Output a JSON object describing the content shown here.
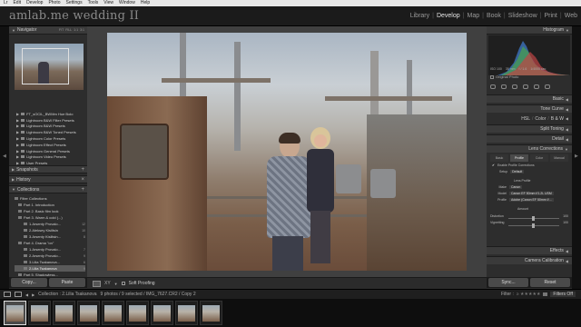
{
  "os_menu": [
    "Lr",
    "Edit",
    "Develop",
    "Photo",
    "Settings",
    "Tools",
    "View",
    "Window",
    "Help"
  ],
  "identity_plate": "amlab.me wedding II",
  "modules": [
    {
      "label": "Library",
      "active": false
    },
    {
      "label": "Develop",
      "active": true
    },
    {
      "label": "Map",
      "active": false
    },
    {
      "label": "Book",
      "active": false
    },
    {
      "label": "Slideshow",
      "active": false
    },
    {
      "label": "Print",
      "active": false
    },
    {
      "label": "Web",
      "active": false
    }
  ],
  "left_panel": {
    "navigator_title": "Navigator",
    "zoom_modes": [
      "FIT",
      "FILL",
      "1:1",
      "3:1"
    ],
    "presets": [
      "FT_sOCIL_BWMm Hue Bolo",
      "Lightroom B&W Filter Presets",
      "Lightroom B&W Presets",
      "Lightroom B&W Toned Presets",
      "Lightroom Color Presets",
      "Lightroom Effect Presets",
      "Lightroom General Presets",
      "Lightroom Video Presets",
      "User Presets"
    ],
    "snapshots_title": "Snapshots",
    "history_title": "History",
    "collections_title": "Collections",
    "collections": [
      {
        "label": "Filter Collections",
        "count": "",
        "selected": false
      },
      {
        "label": "Part 1. Introduction",
        "count": "",
        "selected": false
      },
      {
        "label": "Part 2. Basic film look",
        "count": "",
        "selected": false
      },
      {
        "label": "Part 3. Warm & cold (...)",
        "count": "",
        "selected": false
      },
      {
        "label": "1.Arsenty Provalo...",
        "count": "12",
        "selected": false
      },
      {
        "label": "2.Aleksey Kisiltsin",
        "count": "10",
        "selected": false
      },
      {
        "label": "3.Arsenty Kisiltsin...",
        "count": "8",
        "selected": false
      },
      {
        "label": "Part 4. Drama \"on\"",
        "count": "",
        "selected": false
      },
      {
        "label": "1.Arsenty Provalo...",
        "count": "7",
        "selected": false
      },
      {
        "label": "2.Arsenty Provalo...",
        "count": "9",
        "selected": false
      },
      {
        "label": "3.Lilia Tsakanova...",
        "count": "6",
        "selected": false
      },
      {
        "label": "2.Lilia Tsakanova",
        "count": "9",
        "selected": true
      },
      {
        "label": "Part 5. Shadowless...",
        "count": "",
        "selected": false
      }
    ],
    "copy_label": "Copy...",
    "paste_label": "Paste"
  },
  "toolbar": {
    "xy_label": "XY",
    "soft_proofing_label": "Soft Proofing"
  },
  "right_panel": {
    "histogram_title": "Histogram",
    "histogram_info": [
      "ISO 100",
      "35 mm",
      "f / 1.6",
      "1/4000 sec"
    ],
    "original_photo_label": "Original Photo",
    "sections": [
      "Basic",
      "Tone Curve",
      "Split Toning",
      "Detail",
      "Lens Corrections",
      "Effects",
      "Camera Calibration"
    ],
    "hsl_row": [
      "HSL",
      "Color",
      "B & W"
    ],
    "lens_tabs": [
      {
        "label": "Basic",
        "active": false
      },
      {
        "label": "Profile",
        "active": true
      },
      {
        "label": "Color",
        "active": false
      },
      {
        "label": "Manual",
        "active": false
      }
    ],
    "enable_profile_label": "Enable Profile Corrections",
    "setup_label": "Setup",
    "setup_value": "Default",
    "lens_profile_title": "Lens Profile",
    "make_label": "Make",
    "make_value": "Canon",
    "model_label": "Model",
    "model_value": "Canon EF 50mm f/1.2L USM",
    "profile_label": "Profile",
    "profile_value": "Adobe (Canon EF 50mm f/...",
    "amount_title": "Amount",
    "distortion_label": "Distortion",
    "distortion_value": "100",
    "vignetting_label": "Vignetting",
    "vignetting_value": "100",
    "sync_label": "Sync...",
    "reset_label": "Reset"
  },
  "filmstrip": {
    "path_prefix": "Collection : 2.Lilia Tsakanova",
    "selection_info": "9 photos / 9 selected / IMG_7627.CR2 / Copy 2",
    "filter_label": "Filter :",
    "filters_off_label": "Filters Off",
    "thumb_count": 9,
    "selected_index": 0
  },
  "colors": {
    "panel_bg": "#2d2d2d",
    "header_bg": "#1b1b1b",
    "center_bg": "#404040",
    "active_module": "#e4e4e4"
  }
}
